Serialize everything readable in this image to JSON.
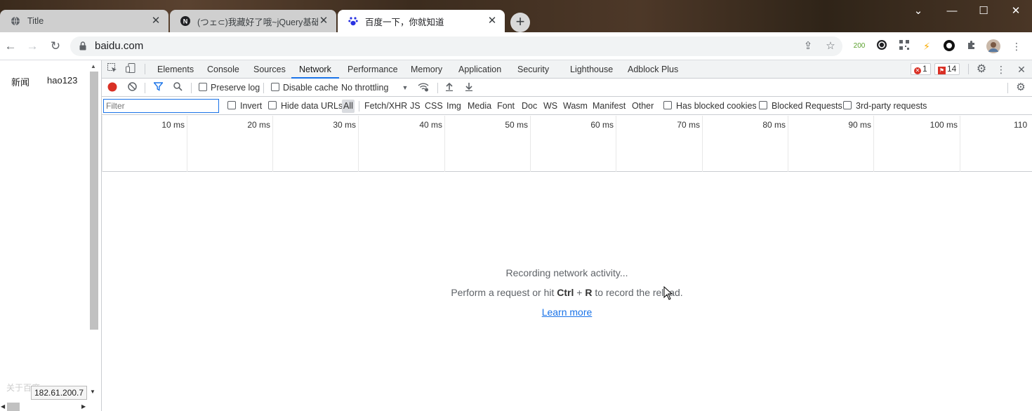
{
  "browser": {
    "tabs": [
      {
        "title": "Title",
        "icon": "globe-icon",
        "active": false
      },
      {
        "title": "(つェ⊂)我藏好了哦~jQuery基础",
        "icon": "n-logo-icon",
        "active": false
      },
      {
        "title": "百度一下，你就知道",
        "icon": "baidu-paw-icon",
        "active": true
      }
    ],
    "new_tab": "+",
    "window_controls": {
      "dropdown": "⌄",
      "minimize": "—",
      "maximize": "☐",
      "close": "✕"
    }
  },
  "toolbar": {
    "url": "baidu.com",
    "extension_badge": "200"
  },
  "page": {
    "links": [
      "新闻",
      "hao123"
    ],
    "footer_link": "关于百度",
    "ip_value": "182.61.200.7"
  },
  "devtools": {
    "tabs": [
      "Elements",
      "Console",
      "Sources",
      "Network",
      "Performance",
      "Memory",
      "Application",
      "Security",
      "Lighthouse",
      "Adblock Plus"
    ],
    "active_tab": "Network",
    "error_count": "1",
    "issue_count": "14",
    "network_toolbar": {
      "preserve_log": "Preserve log",
      "disable_cache": "Disable cache",
      "throttling": "No throttling"
    },
    "filter_bar": {
      "placeholder": "Filter",
      "invert": "Invert",
      "hide_data_urls": "Hide data URLs",
      "types": [
        "All",
        "Fetch/XHR",
        "JS",
        "CSS",
        "Img",
        "Media",
        "Font",
        "Doc",
        "WS",
        "Wasm",
        "Manifest",
        "Other"
      ],
      "selected_type": "All",
      "has_blocked_cookies": "Has blocked cookies",
      "blocked_requests": "Blocked Requests",
      "third_party": "3rd-party requests"
    },
    "overview_ticks": [
      "10 ms",
      "20 ms",
      "30 ms",
      "40 ms",
      "50 ms",
      "60 ms",
      "70 ms",
      "80 ms",
      "90 ms",
      "100 ms",
      "110"
    ],
    "empty_state": {
      "title": "Recording network activity...",
      "hint_before": "Perform a request or hit ",
      "hint_key1": "Ctrl",
      "hint_plus": " + ",
      "hint_key2": "R",
      "hint_after": " to record the reload.",
      "learn_more": "Learn more"
    }
  },
  "colors": {
    "accent": "#1a73e8",
    "record": "#d93025"
  }
}
